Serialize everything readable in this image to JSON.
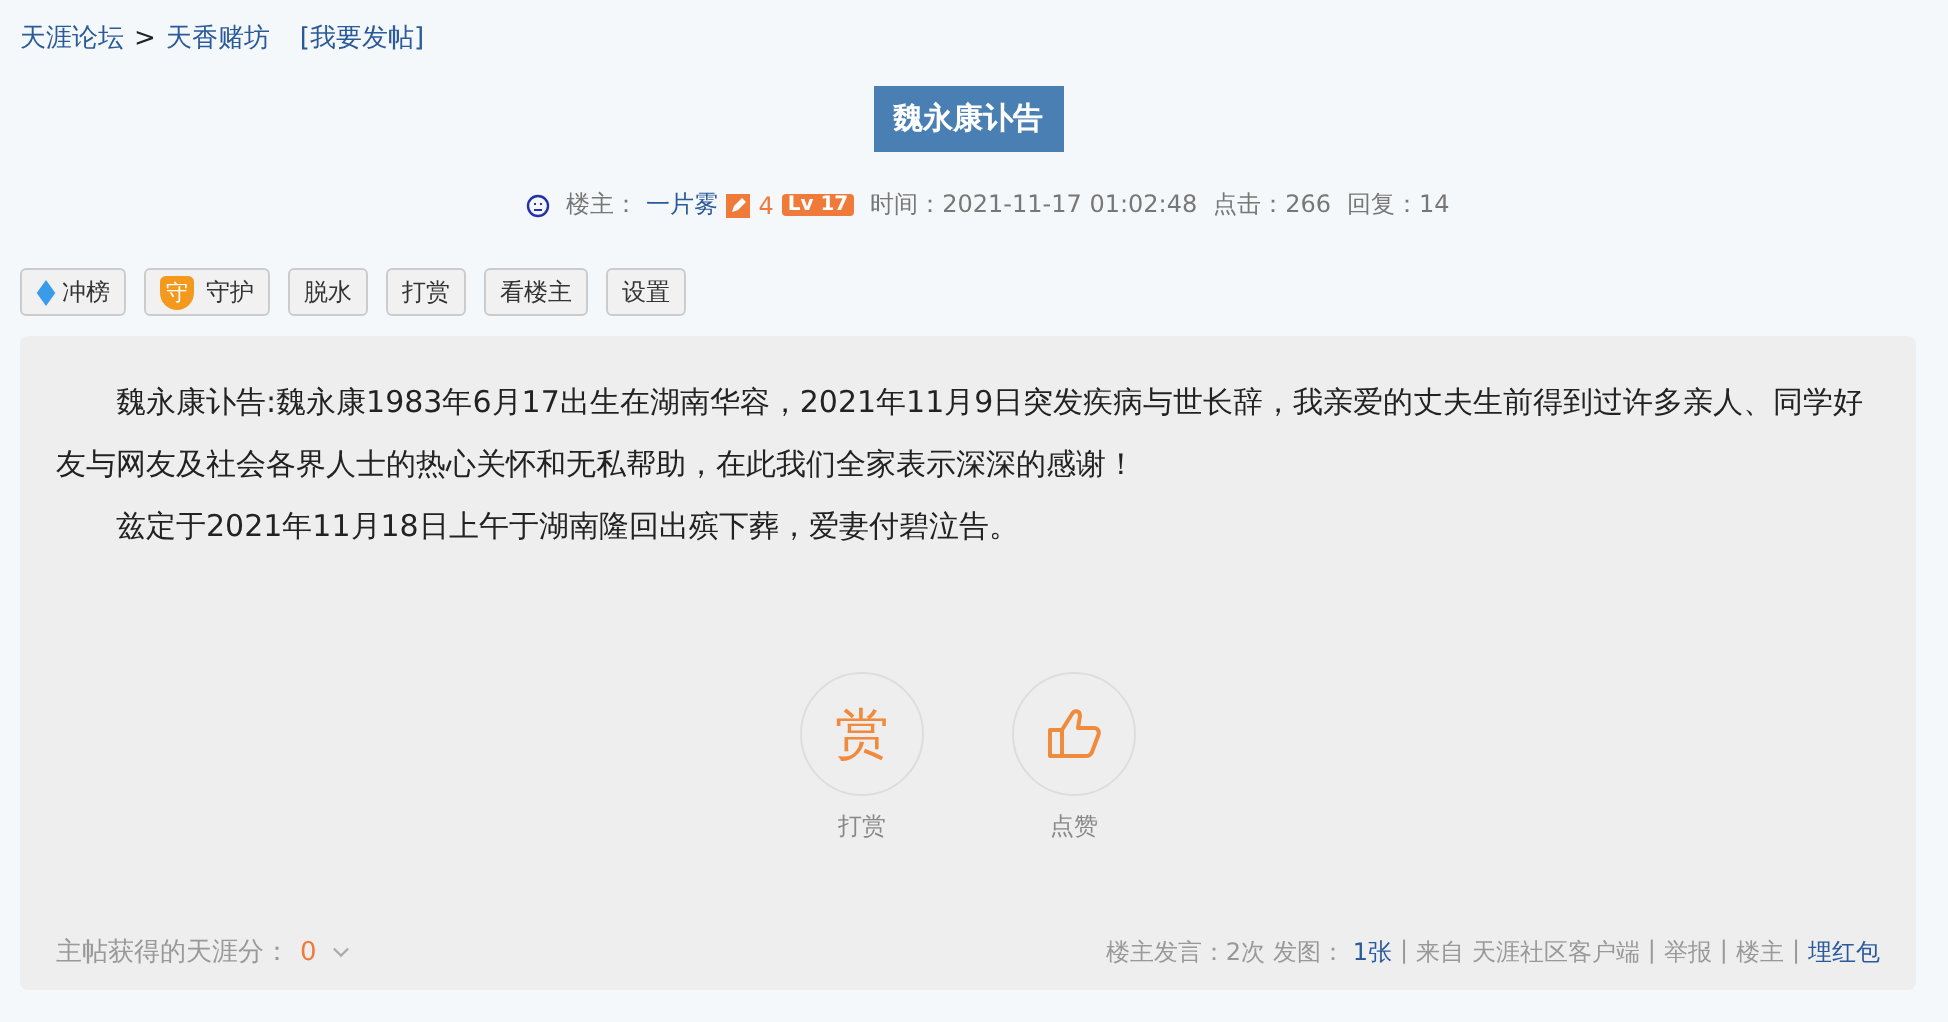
{
  "breadcrumb": [
    {
      "label": "天涯论坛"
    },
    {
      "label": "天香赌坊"
    }
  ],
  "breadcrumb_separator": ">",
  "post_link": "[我要发帖]",
  "title": "魏永康讣告",
  "meta": {
    "author_label": "楼主：",
    "author": "一片雾",
    "edit_count": "4",
    "level": "Lv 17",
    "time": "时间：2021-11-17 01:02:48",
    "clicks": "点击：266",
    "replies": "回复：14"
  },
  "toolbar": [
    {
      "kind": "diamond",
      "label": "冲榜"
    },
    {
      "kind": "shield",
      "icon_text": "守",
      "label": "守护"
    },
    {
      "kind": "plain",
      "label": "脱水"
    },
    {
      "kind": "plain",
      "label": "打赏"
    },
    {
      "kind": "plain",
      "label": "看楼主"
    },
    {
      "kind": "plain",
      "label": "设置"
    }
  ],
  "body": [
    "魏永康讣告:魏永康1983年6月17出生在湖南华容，2021年11月9日突发疾病与世长辞，我亲爱的丈夫生前得到过许多亲人、同学好友与网友及社会各界人士的热心关怀和无私帮助，在此我们全家表示深深的感谢！",
    "兹定于2021年11月18日上午于湖南隆回出殡下葬，爱妻付碧泣告。"
  ],
  "actions": [
    {
      "kind": "reward",
      "glyph": "赏",
      "label": "打赏"
    },
    {
      "kind": "like",
      "label": "点赞"
    }
  ],
  "score": {
    "label": "主帖获得的天涯分：",
    "value": "0"
  },
  "footer": [
    {
      "kind": "text",
      "text": "楼主发言：2次 发图："
    },
    {
      "kind": "link",
      "text": "1张"
    },
    {
      "kind": "sep",
      "text": "|"
    },
    {
      "kind": "text",
      "text": "来自 天涯社区客户端"
    },
    {
      "kind": "sep",
      "text": "|"
    },
    {
      "kind": "text",
      "text": "举报"
    },
    {
      "kind": "sep",
      "text": "|"
    },
    {
      "kind": "text",
      "text": "楼主"
    },
    {
      "kind": "sep",
      "text": "|"
    },
    {
      "kind": "link",
      "text": "埋红包"
    }
  ]
}
